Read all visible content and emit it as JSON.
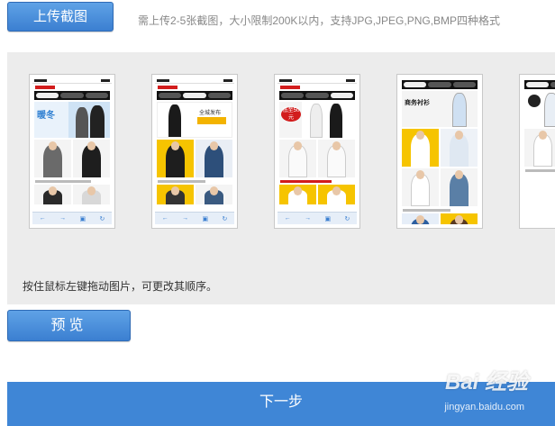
{
  "upload": {
    "button_label": "上传截图",
    "hint": "需上传2-5张截图，大小限制200K以内，支持JPG,JPEG,PNG,BMP四种格式"
  },
  "gallery": {
    "hint": "按住鼠标左键拖动图片，可更改其顺序。",
    "thumbnails": [
      {
        "banner_text": "暖冬"
      },
      {
        "banner_text": "全城发布"
      },
      {
        "banner_text": "低至50元"
      },
      {
        "banner_text": "商务衬衫"
      },
      {
        "banner_text": ""
      }
    ]
  },
  "preview": {
    "button_label": "预览"
  },
  "next": {
    "button_label": "下一步"
  },
  "watermark": {
    "text": "Bai 经验",
    "sub": "jingyan.baidu.com"
  },
  "colors": {
    "accent": "#3b7fd1",
    "next_bar": "#3f86d6",
    "gallery_bg": "#ececec"
  }
}
